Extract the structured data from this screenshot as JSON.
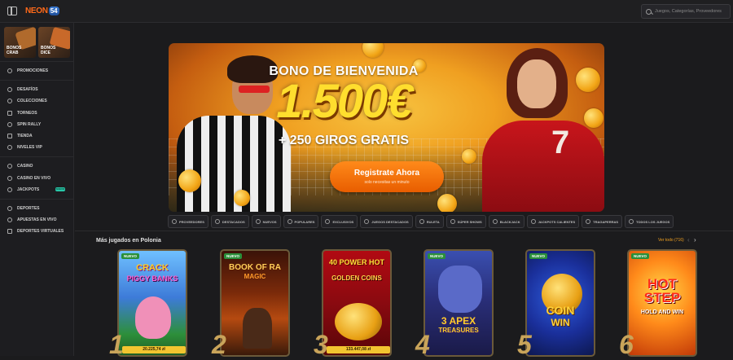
{
  "brand": {
    "logo_text": "NEON",
    "logo_badge": "54"
  },
  "search": {
    "placeholder": "Juegos, Categorías, Proveedores"
  },
  "sidebar": {
    "promo_cards": [
      {
        "label_line1": "BONOS",
        "label_line2": "CRAB"
      },
      {
        "label_line1": "BONOS",
        "label_line2": "DICE"
      }
    ],
    "group1": [
      "PROMOCIONES"
    ],
    "group2": [
      "DESAFÍOS",
      "COLECCIONES",
      "TORNEOS",
      "SPIN RALLY",
      "TIENDA",
      "NIVELES VIP"
    ],
    "group3": [
      "CASINO",
      "CASINO EN VIVO",
      "JACKPOTS"
    ],
    "jackpots_badge": "NUEVO",
    "group4": [
      "DEPORTES",
      "APUESTAS EN VIVO",
      "DEPORTES VIRTUALES"
    ]
  },
  "hero": {
    "kicker": "BONO DE BIENVENIDA",
    "amount": "1.500€",
    "subtitle": "+ 250 GIROS GRATIS",
    "cta_label": "Registrate Ahora",
    "cta_sub": "solo necesitas un minuto",
    "shirt_number": "7"
  },
  "categories": [
    "PROVEEDORES",
    "DESTACADOS",
    "NUEVOS",
    "POPULARES",
    "EXCLUSIVOS",
    "JUEGOS DESTACADOS",
    "RULETA",
    "SÚPER SHOWS",
    "BLACKJACK",
    "JACKPOTS CALIENTES",
    "TRAGAPERRAS",
    "TODOS LOS JUEGOS"
  ],
  "section": {
    "title": "Más jugados en Polonia",
    "see_all": "Ver todo (716)"
  },
  "games": [
    {
      "rank": "1",
      "badge": "NUEVO",
      "title_line1": "CRACK",
      "title_line2": "PIGGY BANKS",
      "win": "20.225,74 zł"
    },
    {
      "rank": "2",
      "badge": "NUEVO",
      "title_line1": "BOOK OF RA",
      "title_line2": "MAGIC",
      "win": ""
    },
    {
      "rank": "3",
      "badge": "",
      "title_line1": "40 POWER HOT",
      "title_line2": "GOLDEN COINS",
      "win": "133.447,08 zł"
    },
    {
      "rank": "4",
      "badge": "NUEVO",
      "title_line1": "3 APEX",
      "title_line2": "TREASURES",
      "win": ""
    },
    {
      "rank": "5",
      "badge": "NUEVO",
      "title_line1": "COIN",
      "title_line2": "WIN",
      "win": ""
    },
    {
      "rank": "6",
      "badge": "NUEVO",
      "title_line1": "HOT STEP",
      "title_line2": "HOLD AND WIN",
      "win": ""
    }
  ]
}
